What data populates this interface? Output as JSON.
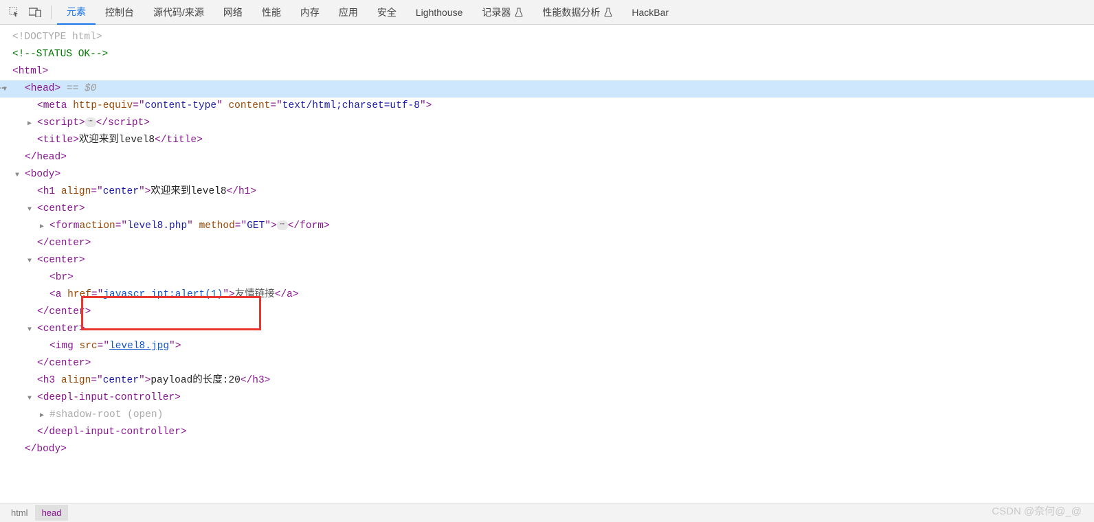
{
  "toolbar": {
    "tabs": {
      "elements": "元素",
      "console": "控制台",
      "sources": "源代码/来源",
      "network": "网络",
      "performance": "性能",
      "memory": "内存",
      "application": "应用",
      "security": "安全",
      "lighthouse": "Lighthouse",
      "recorder": "记录器",
      "perf_insights": "性能数据分析",
      "hackbar": "HackBar"
    }
  },
  "dom": {
    "doctype": "<!DOCTYPE html>",
    "comment": "<!--STATUS OK-->",
    "html_open": "<html>",
    "head_open": "<head>",
    "head_selected_suffix": " == $0",
    "meta": {
      "tag": "meta",
      "attr1_name": "http-equiv",
      "attr1_val": "content-type",
      "attr2_name": "content",
      "attr2_val": "text/html;charset=utf-8"
    },
    "script_open": "<script>",
    "script_close_txt": "script",
    "title": {
      "tag": "title",
      "text": "欢迎来到level8"
    },
    "head_close": "</head>",
    "body_open": "<body>",
    "h1": {
      "align": "center",
      "text": "欢迎来到level8"
    },
    "center1": {
      "open": "<center>",
      "close": "</center>"
    },
    "form": {
      "action": "level8.php",
      "method": "GET"
    },
    "center2": {
      "open": "<center>",
      "close": "</center>"
    },
    "br": "<br>",
    "a": {
      "href": "javascr_ipt:alert(1)",
      "text": "友情链接"
    },
    "center3": {
      "open": "<center>",
      "close": "</center>"
    },
    "img": {
      "src": "level8.jpg"
    },
    "h3": {
      "align": "center",
      "text": "payload的长度:20"
    },
    "deepl_open": "<deepl-input-controller>",
    "shadow": "#shadow-root (open)",
    "deepl_close": "</deepl-input-controller>",
    "body_close": "</body>"
  },
  "breadcrumb": {
    "item1": "html",
    "item2": "head"
  },
  "watermark": "CSDN @奈何@_@"
}
